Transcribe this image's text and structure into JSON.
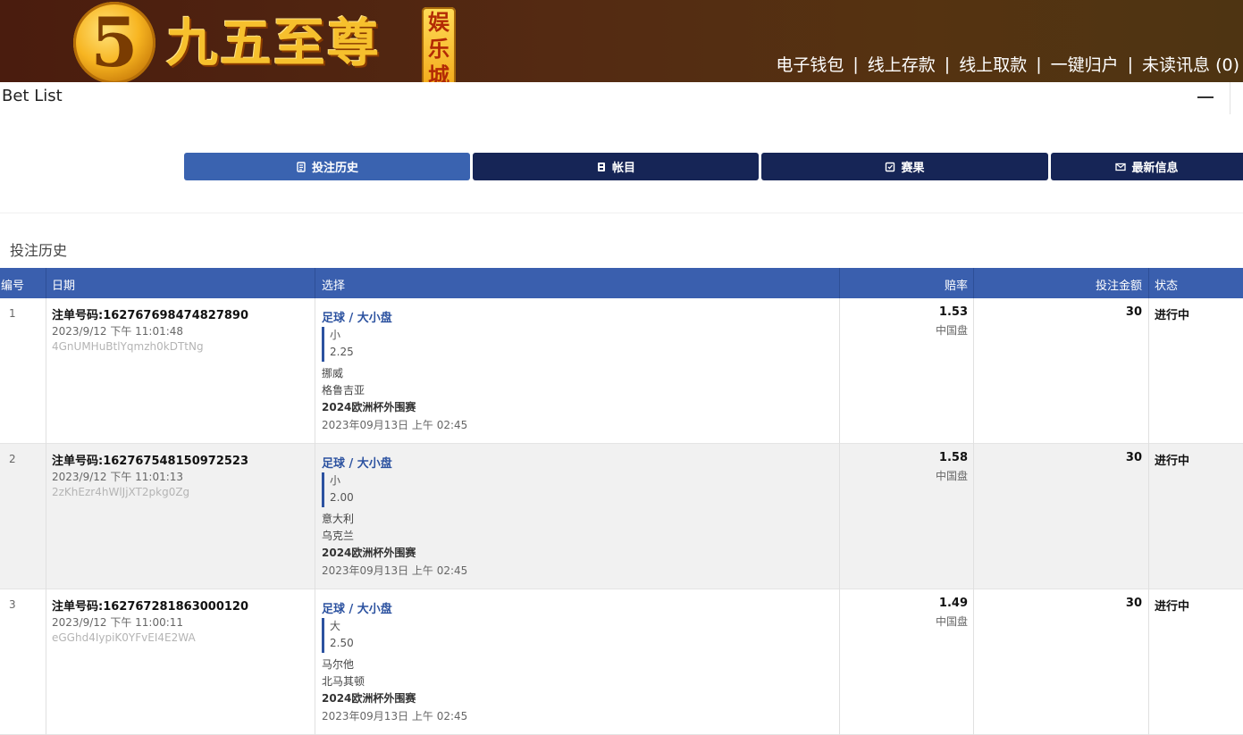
{
  "header": {
    "logo_numeral": "5",
    "logo_text": "九五至尊",
    "logo_badge": [
      "娱",
      "乐",
      "城"
    ],
    "nav": [
      {
        "label": "电子钱包"
      },
      {
        "label": "线上存款"
      },
      {
        "label": "线上取款"
      },
      {
        "label": "一键归户"
      },
      {
        "label": "未读讯息 (0)"
      }
    ],
    "nav_separator": "|"
  },
  "window": {
    "title": "Bet List"
  },
  "tabs": [
    {
      "label": "投注历史",
      "icon": "receipt-icon",
      "active": true
    },
    {
      "label": "帐目",
      "icon": "ledger-icon",
      "active": false
    },
    {
      "label": "赛果",
      "icon": "results-icon",
      "active": false
    },
    {
      "label": "最新信息",
      "icon": "mail-icon",
      "active": false
    }
  ],
  "section_title": "投注历史",
  "table": {
    "columns": [
      "编号",
      "日期",
      "选择",
      "赔率",
      "投注金额",
      "状态"
    ],
    "rows": [
      {
        "num": "1",
        "order": "注单号码:162767698474827890",
        "time": "2023/9/12 下午 11:01:48",
        "code": "4GnUMHuBtlYqmzh0kDTtNg",
        "sport": "足球 / 大小盘",
        "pick": "小",
        "line": "2.25",
        "home": "挪威",
        "away": "格鲁吉亚",
        "league": "2024欧洲杯外围赛",
        "match_time": "2023年09月13日 上午 02:45",
        "odds": "1.53",
        "market": "中国盘",
        "stake": "30",
        "status": "进行中"
      },
      {
        "num": "2",
        "order": "注单号码:162767548150972523",
        "time": "2023/9/12 下午 11:01:13",
        "code": "2zKhEzr4hWlJjXT2pkg0Zg",
        "sport": "足球 / 大小盘",
        "pick": "小",
        "line": "2.00",
        "home": "意大利",
        "away": "乌克兰",
        "league": "2024欧洲杯外围赛",
        "match_time": "2023年09月13日 上午 02:45",
        "odds": "1.58",
        "market": "中国盘",
        "stake": "30",
        "status": "进行中"
      },
      {
        "num": "3",
        "order": "注单号码:162767281863000120",
        "time": "2023/9/12 下午 11:00:11",
        "code": "eGGhd4IypiK0YFvEI4E2WA",
        "sport": "足球 / 大小盘",
        "pick": "大",
        "line": "2.50",
        "home": "马尔他",
        "away": "北马其顿",
        "league": "2024欧洲杯外围赛",
        "match_time": "2023年09月13日 上午 02:45",
        "odds": "1.49",
        "market": "中国盘",
        "stake": "30",
        "status": "进行中"
      }
    ]
  },
  "colors": {
    "banner": "#4a1c0e",
    "tab_active": "#3a63b0",
    "tab_inactive": "#162556",
    "table_header": "#3a5fae",
    "link_blue": "#2c52a0",
    "logo_gold": "#f6c02d"
  }
}
